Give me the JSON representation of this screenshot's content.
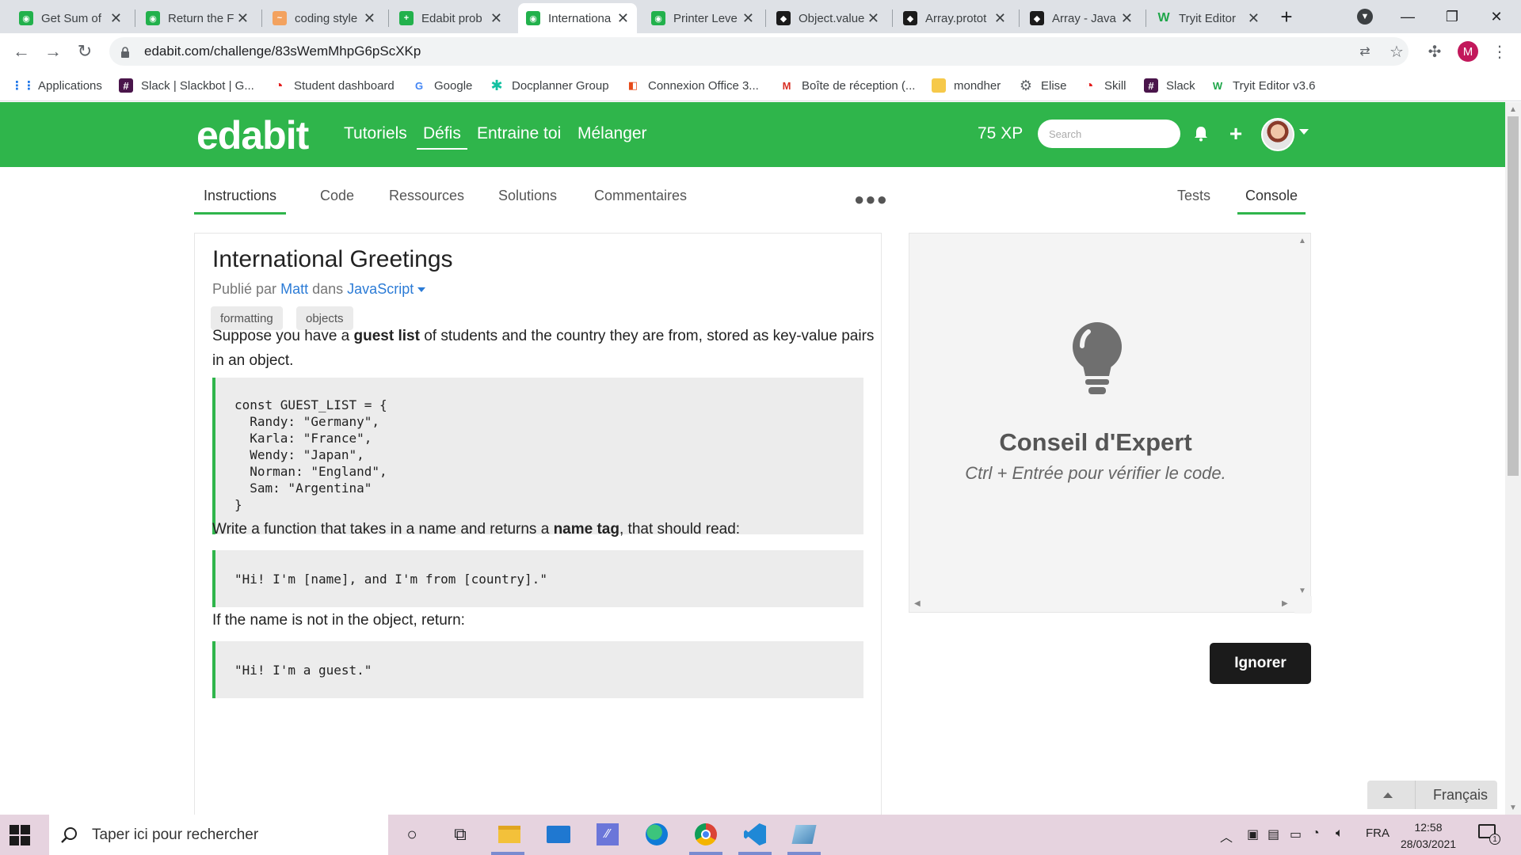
{
  "browser": {
    "tabs": [
      {
        "title": "Get Sum of",
        "icon": "edabit"
      },
      {
        "title": "Return the F",
        "icon": "edabit"
      },
      {
        "title": "coding style",
        "icon": "orange"
      },
      {
        "title": "Edabit prob",
        "icon": "google-sheets"
      },
      {
        "title": "Internationa",
        "icon": "edabit",
        "active": true
      },
      {
        "title": "Printer Leve",
        "icon": "edabit"
      },
      {
        "title": "Object.value",
        "icon": "mdn"
      },
      {
        "title": "Array.protot",
        "icon": "mdn"
      },
      {
        "title": "Array - Java",
        "icon": "mdn"
      },
      {
        "title": "Tryit Editor",
        "icon": "w3schools"
      }
    ],
    "url": "edabit.com/challenge/83sWemMhpG6pScXKp",
    "profile_initial": "M",
    "bookmarks": [
      "Applications",
      "Slack | Slackbot | G...",
      "Student dashboard",
      "Google",
      "Docplanner Group",
      "Connexion Office 3...",
      "Boîte de réception (...",
      "mondher",
      "Elise",
      "Skill",
      "Slack",
      "Tryit Editor v3.6"
    ]
  },
  "header": {
    "logo": "edabit",
    "nav": [
      "Tutoriels",
      "Défis",
      "Entraine toi",
      "Mélanger"
    ],
    "active_nav": "Défis",
    "xp": "75 XP",
    "search_placeholder": "Search"
  },
  "subtabs": {
    "left": [
      "Instructions",
      "Code",
      "Ressources",
      "Solutions",
      "Commentaires"
    ],
    "right": [
      "Tests",
      "Console"
    ],
    "active_left": "Instructions",
    "active_right": "Console"
  },
  "challenge": {
    "title": "International Greetings",
    "published_by": "Publié par",
    "author": "Matt",
    "in_word": "dans",
    "language": "JavaScript",
    "tags": [
      "formatting",
      "objects"
    ],
    "para1_before": "Suppose you have a ",
    "para1_bold": "guest list",
    "para1_after": " of students and the country they are from, stored as key-value pairs in an object.",
    "code1": "const GUEST_LIST = {\n  Randy: \"Germany\",\n  Karla: \"France\",\n  Wendy: \"Japan\",\n  Norman: \"England\",\n  Sam: \"Argentina\"\n}",
    "para2_before": "Write a function that takes in a name and returns a ",
    "para2_bold": "name tag",
    "para2_after": ", that should read:",
    "code2": "\"Hi! I'm [name], and I'm from [country].\"",
    "para3": "If the name is not in the object, return:",
    "code3": "\"Hi! I'm a guest.\""
  },
  "console": {
    "tip_title": "Conseil d'Expert",
    "tip_text": "Ctrl + Entrée pour vérifier le code.",
    "ignore_button": "Ignorer"
  },
  "language_selector": "Français",
  "taskbar": {
    "search_placeholder": "Taper ici pour rechercher",
    "lang": "FRA",
    "time": "12:58",
    "date": "28/03/2021",
    "notification_count": "1"
  },
  "colors": {
    "brand_green": "#2fb54b",
    "link_blue": "#2b7bd6",
    "dark_button": "#1b1b1b"
  }
}
